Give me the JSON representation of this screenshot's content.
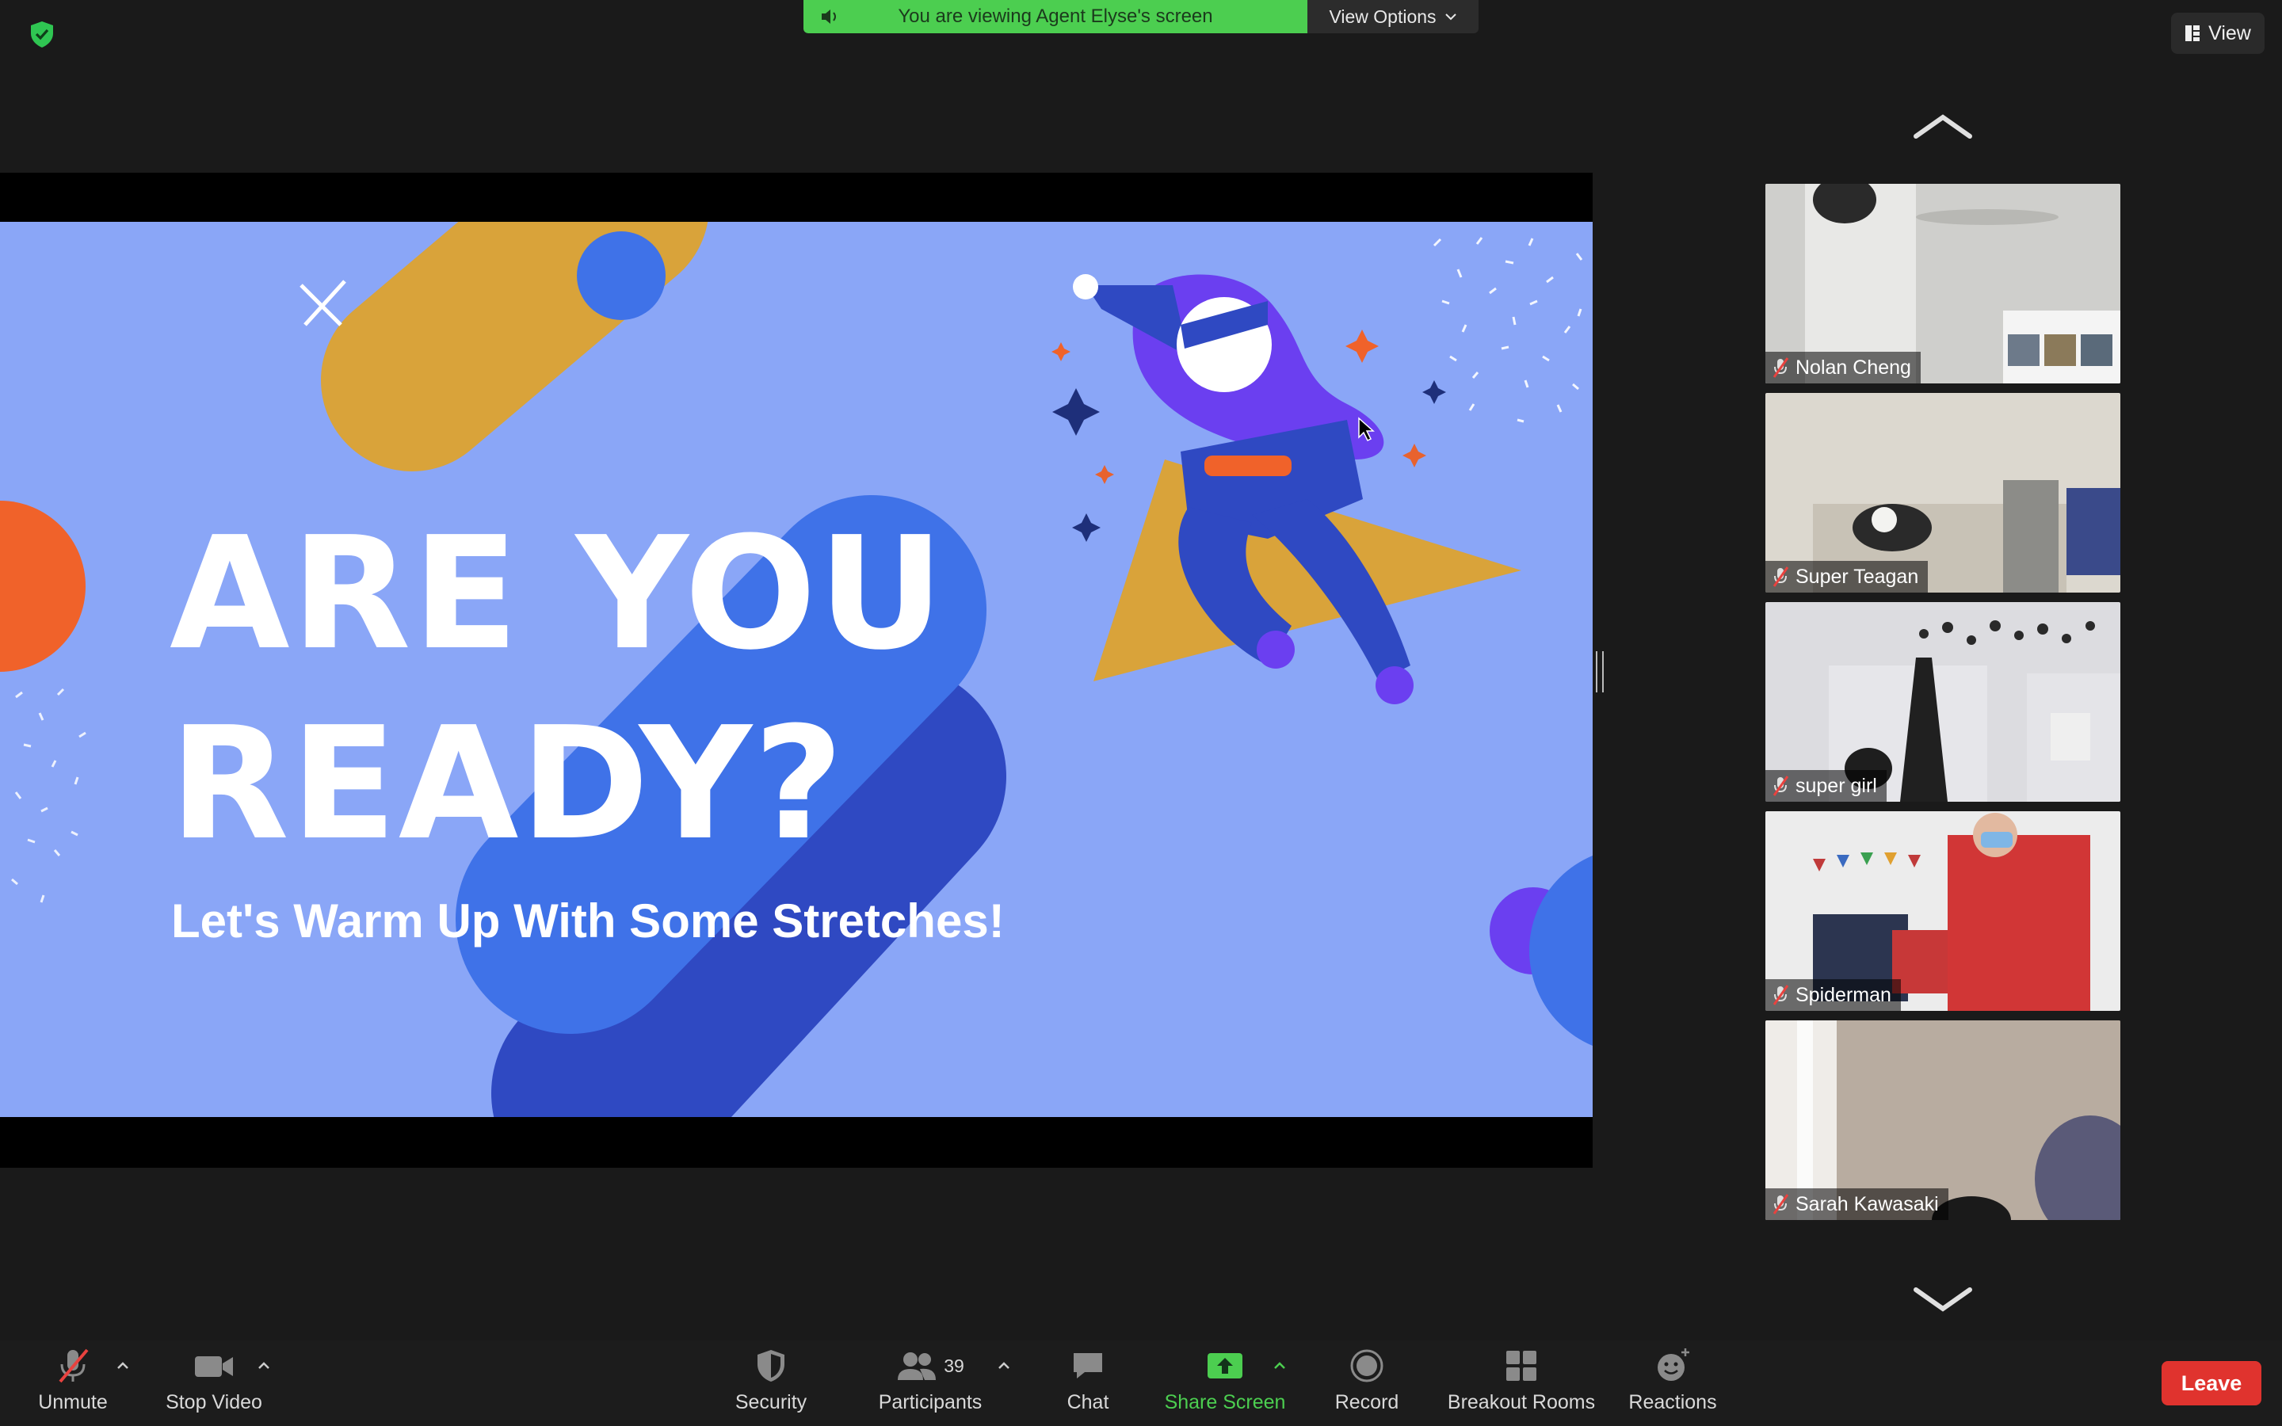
{
  "banner": {
    "text": "You are viewing Agent Elyse's screen",
    "color": "#4cce50"
  },
  "view_options": {
    "label": "View Options"
  },
  "view_button": {
    "label": "View"
  },
  "slide": {
    "title_line1": "ARE YOU",
    "title_line2": "READY?",
    "subtitle": "Let's Warm Up With Some Stretches!",
    "background_color": "#8aa6f7"
  },
  "participants": [
    {
      "name": "Nolan Cheng",
      "muted": true
    },
    {
      "name": "Super Teagan",
      "muted": true
    },
    {
      "name": "super girl",
      "muted": true
    },
    {
      "name": "Spiderman",
      "muted": true
    },
    {
      "name": "Sarah Kawasaki",
      "muted": true
    }
  ],
  "toolbar": {
    "unmute": "Unmute",
    "stop_video": "Stop Video",
    "security": "Security",
    "participants": "Participants",
    "participant_count": "39",
    "chat": "Chat",
    "share_screen": "Share Screen",
    "record": "Record",
    "breakout_rooms": "Breakout Rooms",
    "reactions": "Reactions",
    "leave": "Leave"
  },
  "colors": {
    "leave": "#e0332e",
    "share_green": "#4cce50",
    "toolbar_bg": "#1c1c1c"
  }
}
